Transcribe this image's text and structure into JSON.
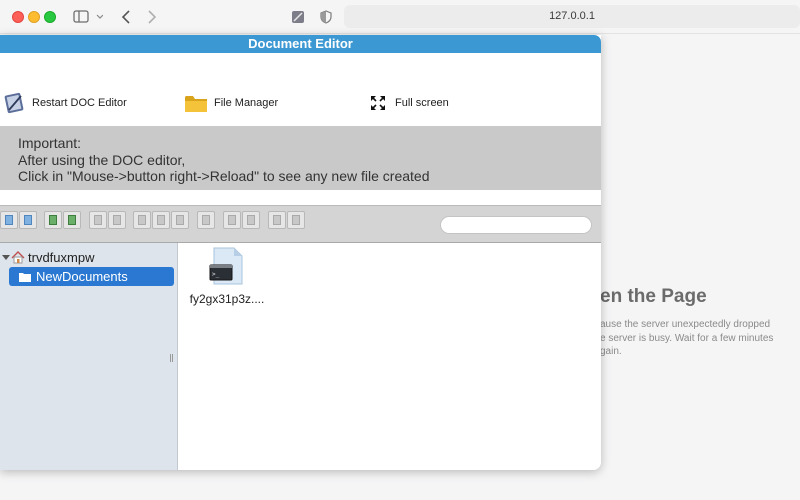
{
  "browser": {
    "address": "127.0.0.1"
  },
  "error_page": {
    "title": "en the Page",
    "lines": [
      "ause the server unexpectedly dropped",
      "e server is busy. Wait for a few minutes",
      "gain."
    ]
  },
  "popup": {
    "title": "Document Editor",
    "actions": {
      "restart": "Restart DOC Editor",
      "file_manager": "File Manager",
      "full_screen": "Full screen"
    },
    "notice": {
      "line1": "Important:",
      "line2": "After using the DOC editor,",
      "line3": "Click in \"Mouse->button right->Reload\" to see any new file created"
    },
    "tree": {
      "root": "trvdfuxmpw",
      "selected": "NewDocuments"
    },
    "files": [
      {
        "name": "fy2gx31p3z....",
        "icon": "terminal-file-icon"
      }
    ]
  },
  "colors": {
    "title_bar": "#3b98d3",
    "selection": "#2a78d1",
    "notice_bg": "#c9c9c9"
  }
}
